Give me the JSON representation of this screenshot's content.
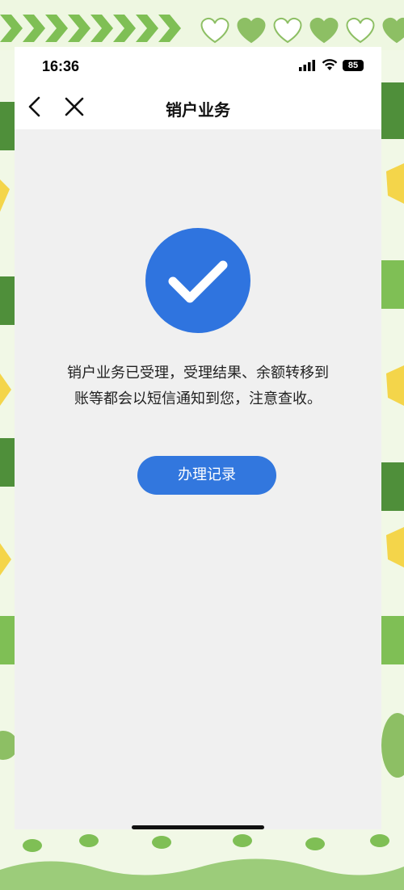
{
  "status_bar": {
    "time": "16:36",
    "battery": "85"
  },
  "nav": {
    "title": "销户业务",
    "back_icon": "chevron-left-icon",
    "close_icon": "close-icon"
  },
  "result": {
    "icon": "checkmark-circle-icon",
    "message_line1": "销户业务已受理，受理结果、余额转移到",
    "message_line2": "账等都会以短信通知到您，注意查收。"
  },
  "actions": {
    "record_label": "办理记录"
  },
  "colors": {
    "accent": "#2f74df",
    "screen_bg": "#f0f0f0",
    "frame_green": "#8dbf64"
  }
}
